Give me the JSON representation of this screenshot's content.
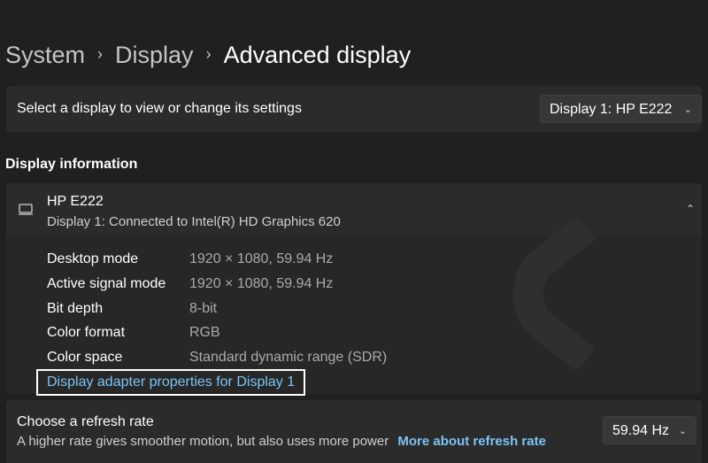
{
  "breadcrumb": {
    "items": [
      "System",
      "Display"
    ],
    "current": "Advanced display",
    "separator": "›"
  },
  "select_display": {
    "label": "Select a display to view or change its settings",
    "selected": "Display 1: HP E222"
  },
  "display_information": {
    "title": "Display information",
    "device_name": "HP E222",
    "device_subtitle": "Display 1: Connected to Intel(R) HD Graphics 620",
    "properties": [
      {
        "label": "Desktop mode",
        "value": "1920 × 1080, 59.94 Hz"
      },
      {
        "label": "Active signal mode",
        "value": "1920 × 1080, 59.94 Hz"
      },
      {
        "label": "Bit depth",
        "value": "8-bit"
      },
      {
        "label": "Color format",
        "value": "RGB"
      },
      {
        "label": "Color space",
        "value": "Standard dynamic range (SDR)"
      }
    ],
    "adapter_link": "Display adapter properties for Display 1"
  },
  "refresh_rate": {
    "title": "Choose a refresh rate",
    "description": "A higher rate gives smoother motion, but also uses more power",
    "link": "More about refresh rate",
    "selected": "59.94 Hz"
  },
  "icons": {
    "chevron": "chevron-down-icon",
    "monitor": "monitor-icon",
    "collapse": "chevron-up-icon"
  },
  "colors": {
    "background": "#202020",
    "card": "#2b2b2b",
    "link": "#7cc4f5"
  }
}
